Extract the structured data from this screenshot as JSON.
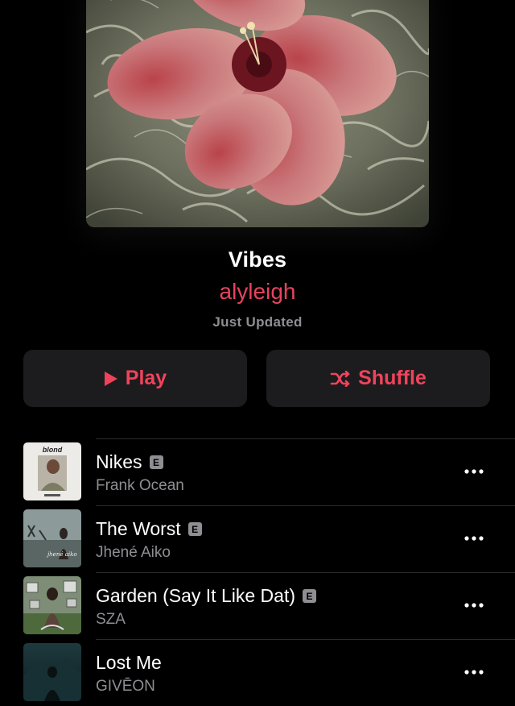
{
  "playlist": {
    "title": "Vibes",
    "curator": "alyleigh",
    "status": "Just Updated"
  },
  "buttons": {
    "play_label": "Play",
    "shuffle_label": "Shuffle"
  },
  "colors": {
    "accent": "#f0435b",
    "background": "#000000",
    "button_bg": "#1c1c1e",
    "secondary_text": "#8e8e93"
  },
  "songs": [
    {
      "title": "Nikes",
      "artist": "Frank Ocean",
      "explicit": true,
      "explicit_label": "E",
      "cover_text": "blond"
    },
    {
      "title": "The Worst",
      "artist": "Jhené Aiko",
      "explicit": true,
      "explicit_label": "E"
    },
    {
      "title": "Garden (Say It Like Dat)",
      "artist": "SZA",
      "explicit": true,
      "explicit_label": "E"
    },
    {
      "title": "Lost Me",
      "artist": "GIVĒON",
      "explicit": false
    }
  ],
  "icons": {
    "play": "play-icon",
    "shuffle": "shuffle-icon",
    "more": "more-icon"
  }
}
